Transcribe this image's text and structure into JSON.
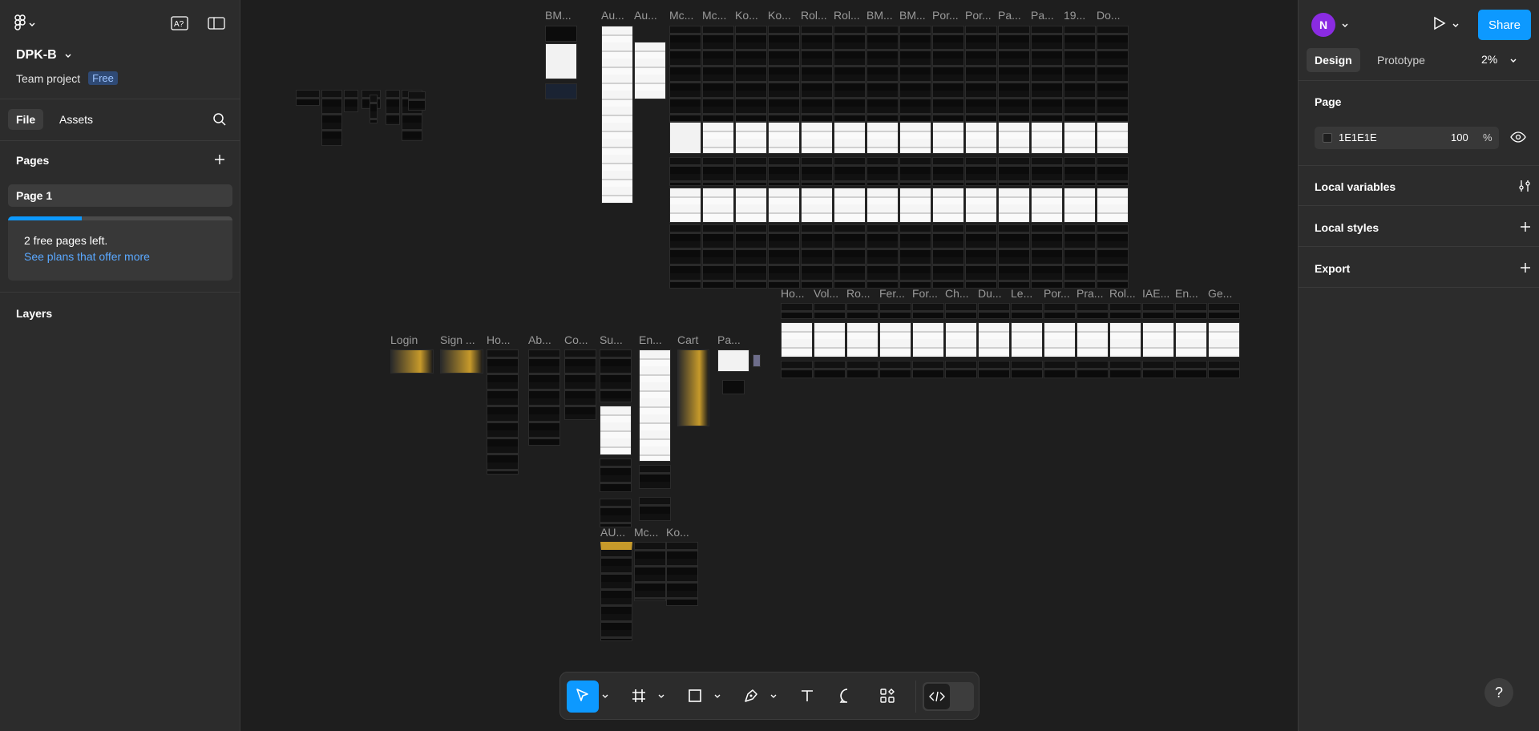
{
  "file": {
    "name": "DPK-B",
    "team": "Team project",
    "plan_badge": "Free"
  },
  "left_panel": {
    "tabs": [
      "File",
      "Assets"
    ],
    "pages_title": "Pages",
    "page_item": "Page 1",
    "upsell": {
      "text": "2 free pages left.",
      "link": "See plans that offer more",
      "progress": 0.33
    },
    "layers_title": "Layers"
  },
  "right_panel": {
    "avatar_initial": "N",
    "share_label": "Share",
    "tabs": [
      "Design",
      "Prototype"
    ],
    "zoom": "2%",
    "page_section": "Page",
    "page_color": "1E1E1E",
    "page_opacity": "100",
    "percent_sign": "%",
    "local_variables": "Local variables",
    "local_styles": "Local styles",
    "export": "Export",
    "help": "?"
  },
  "canvas": {
    "top_row_labels": [
      "BM...",
      "Au...",
      "Au...",
      "Mc...",
      "Mc...",
      "Ko...",
      "Ko...",
      "Rol...",
      "Rol...",
      "BM...",
      "BM...",
      "Por...",
      "Por...",
      "Pa...",
      "Pa...",
      "19...",
      "Do..."
    ],
    "mid_row_labels": [
      "Ho...",
      "Vol...",
      "Ro...",
      "Fer...",
      "For...",
      "Ch...",
      "Du...",
      "Le...",
      "Por...",
      "Pra...",
      "Rol...",
      "IAE...",
      "En...",
      "Ge..."
    ],
    "main_row_labels": [
      "Login",
      "Sign ...",
      "Ho...",
      "Ab...",
      "Co...",
      "Su...",
      "En...",
      "Cart",
      "Pa..."
    ],
    "bottom_row_labels": [
      "AU...",
      "Mc...",
      "Ko..."
    ]
  },
  "toolbar": {
    "tools": [
      "move-tool",
      "frame-tool",
      "rectangle-tool",
      "pen-tool",
      "text-tool",
      "comment-tool",
      "actions-tool"
    ]
  },
  "colors": {
    "accent": "#0d99ff",
    "canvas_bg": "#1e1e1e",
    "panel_bg": "#2c2c2c",
    "avatar": "#8a2be2"
  }
}
